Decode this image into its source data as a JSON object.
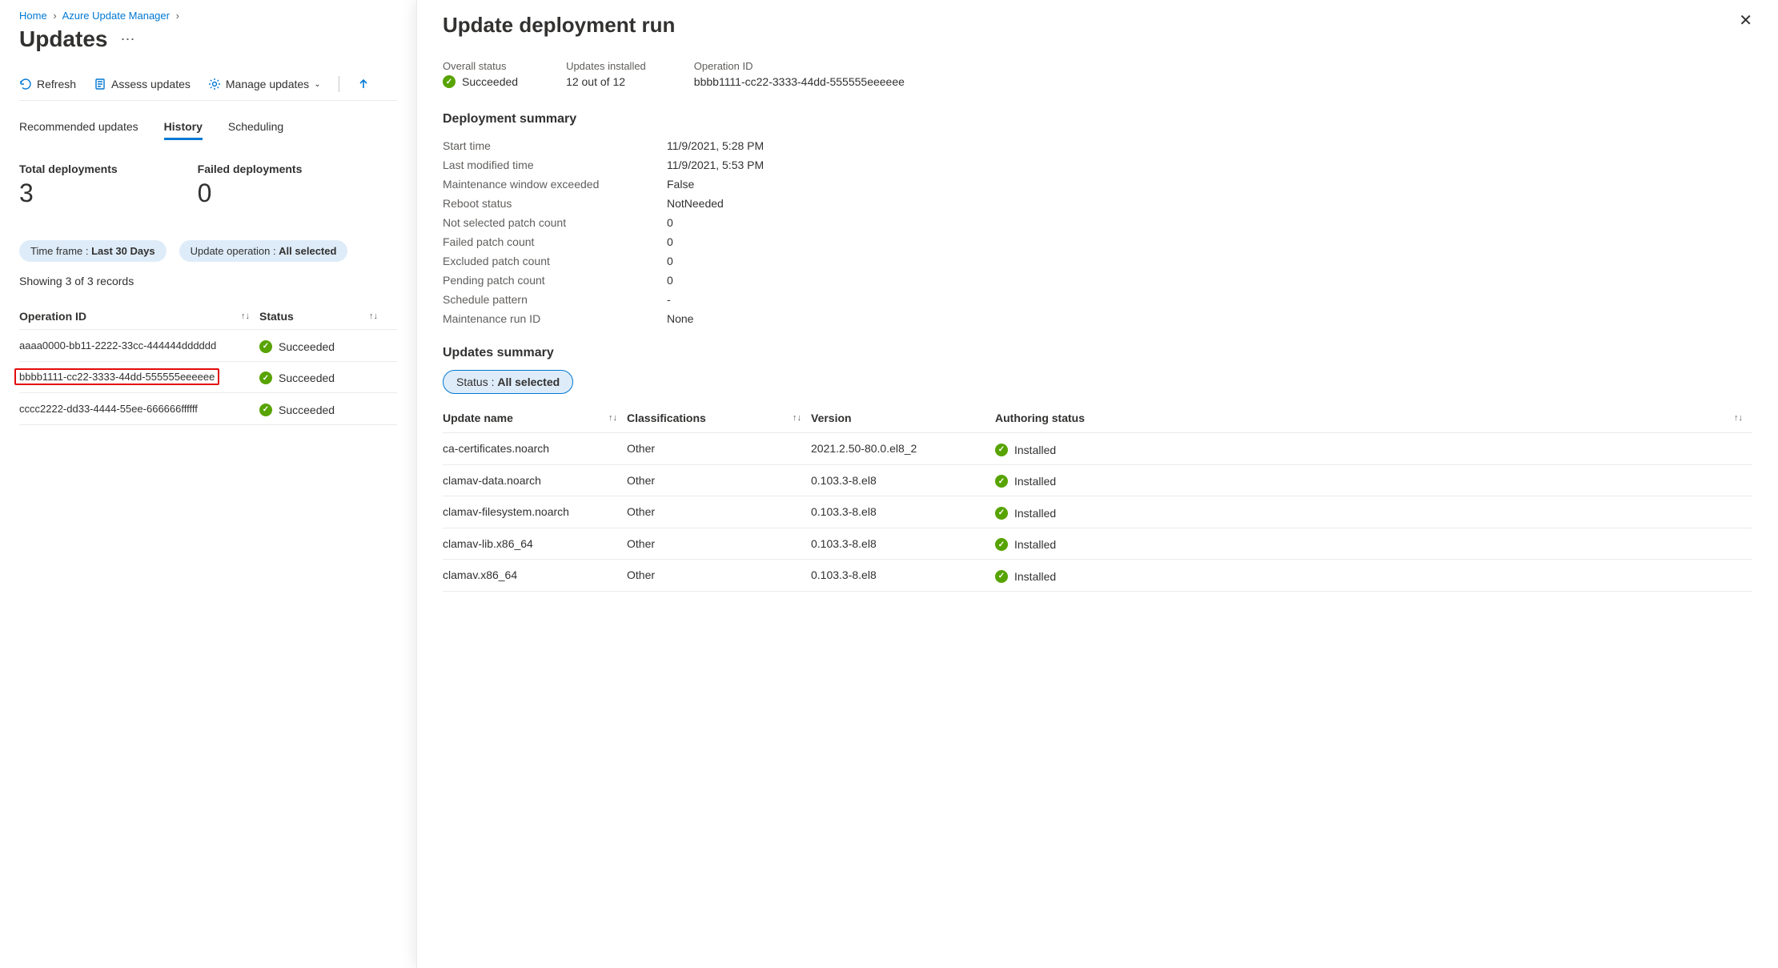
{
  "breadcrumb": {
    "home": "Home",
    "mgr": "Azure Update Manager"
  },
  "page": {
    "title": "Updates"
  },
  "toolbar": {
    "refresh": "Refresh",
    "assess": "Assess updates",
    "manage": "Manage updates"
  },
  "tabs": {
    "rec": "Recommended updates",
    "history": "History",
    "sched": "Scheduling"
  },
  "stats": {
    "total_label": "Total deployments",
    "total_value": "3",
    "failed_label": "Failed deployments",
    "failed_value": "0"
  },
  "filters": {
    "tf_label": "Time frame : ",
    "tf_value": "Last 30 Days",
    "op_label": "Update operation : ",
    "op_value": "All selected"
  },
  "records_text": "Showing 3 of 3 records",
  "history_header": {
    "op": "Operation ID",
    "status": "Status"
  },
  "history_rows": [
    {
      "id": "aaaa0000-bb11-2222-33cc-444444dddddd",
      "status": "Succeeded",
      "selected": false
    },
    {
      "id": "bbbb1111-cc22-3333-44dd-555555eeeeee",
      "status": "Succeeded",
      "selected": true
    },
    {
      "id": "cccc2222-dd33-4444-55ee-666666ffffff",
      "status": "Succeeded",
      "selected": false
    }
  ],
  "pane": {
    "title": "Update deployment run",
    "overview": {
      "status_label": "Overall status",
      "status_value": "Succeeded",
      "installed_label": "Updates installed",
      "installed_value": "12 out of 12",
      "opid_label": "Operation ID",
      "opid_value": "bbbb1111-cc22-3333-44dd-555555eeeeee"
    },
    "summary_title": "Deployment summary",
    "summary": [
      {
        "label": "Start time",
        "value": "11/9/2021, 5:28 PM"
      },
      {
        "label": "Last modified time",
        "value": "11/9/2021, 5:53 PM"
      },
      {
        "label": "Maintenance window exceeded",
        "value": "False"
      },
      {
        "label": "Reboot status",
        "value": "NotNeeded"
      },
      {
        "label": "Not selected patch count",
        "value": "0"
      },
      {
        "label": "Failed patch count",
        "value": "0"
      },
      {
        "label": "Excluded patch count",
        "value": "0"
      },
      {
        "label": "Pending patch count",
        "value": "0"
      },
      {
        "label": "Schedule pattern",
        "value": "-"
      },
      {
        "label": "Maintenance run ID",
        "value": "None"
      }
    ],
    "updates_title": "Updates summary",
    "status_filter_label": "Status : ",
    "status_filter_value": "All selected",
    "upd_header": {
      "name": "Update name",
      "class": "Classifications",
      "ver": "Version",
      "auth": "Authoring status"
    },
    "updates": [
      {
        "name": "ca-certificates.noarch",
        "class": "Other",
        "ver": "2021.2.50-80.0.el8_2",
        "auth": "Installed"
      },
      {
        "name": "clamav-data.noarch",
        "class": "Other",
        "ver": "0.103.3-8.el8",
        "auth": "Installed"
      },
      {
        "name": "clamav-filesystem.noarch",
        "class": "Other",
        "ver": "0.103.3-8.el8",
        "auth": "Installed"
      },
      {
        "name": "clamav-lib.x86_64",
        "class": "Other",
        "ver": "0.103.3-8.el8",
        "auth": "Installed"
      },
      {
        "name": "clamav.x86_64",
        "class": "Other",
        "ver": "0.103.3-8.el8",
        "auth": "Installed"
      }
    ]
  }
}
